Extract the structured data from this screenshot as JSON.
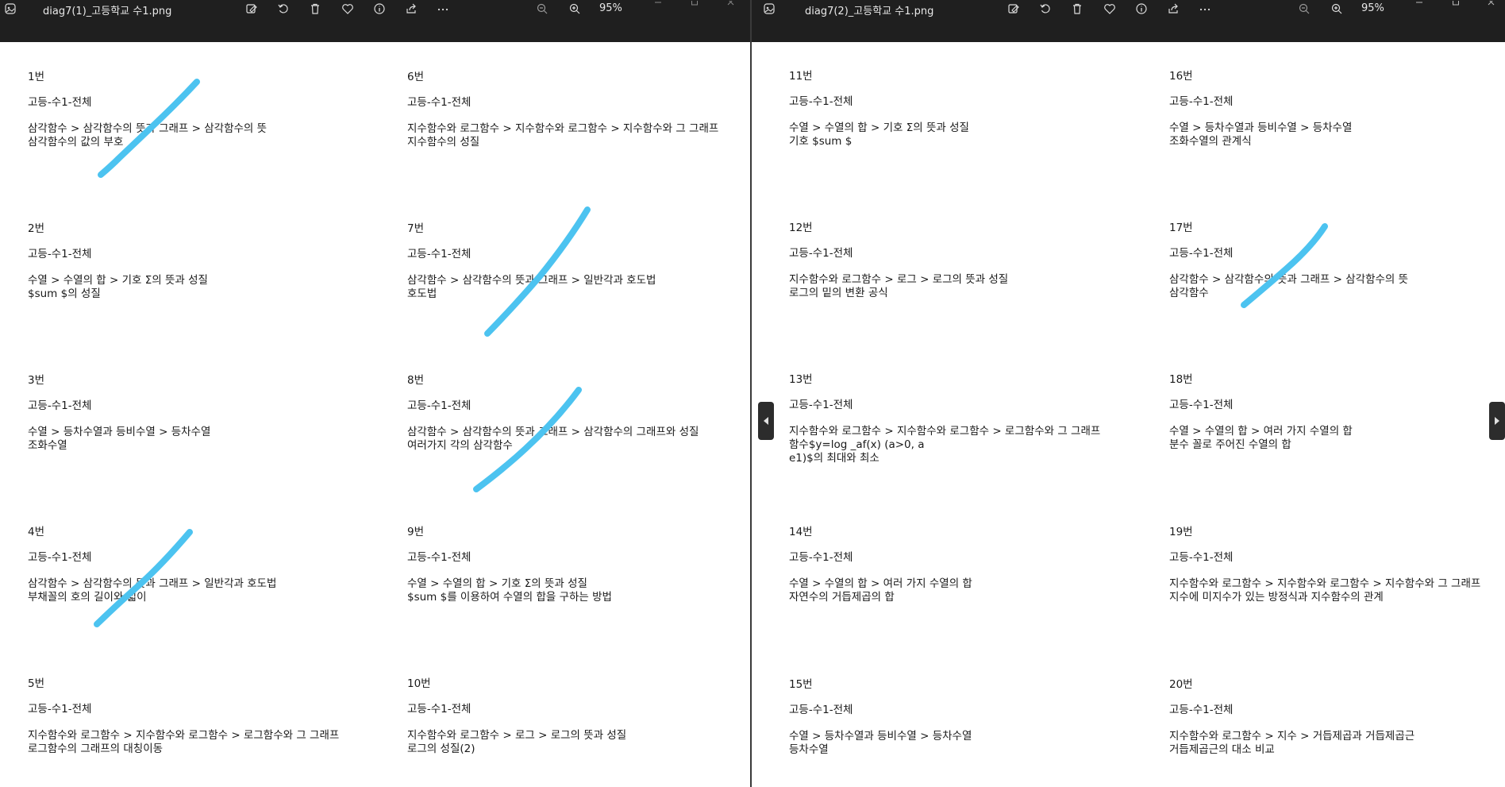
{
  "windows": [
    {
      "filename": "diag7(1)_고등학교 수1.png",
      "zoom": "95%",
      "items": [
        {
          "num": "1번",
          "grade": "고등-수1-전체",
          "path": "삼각함수 > 삼각함수의 뜻과 그래프 > 삼각함수의 뜻",
          "topic": "삼각함수의 값의 부호"
        },
        {
          "num": "2번",
          "grade": "고등-수1-전체",
          "path": "수열 > 수열의 합 > 기호 Σ의 뜻과 성질",
          "topic": "$sum $의 성질"
        },
        {
          "num": "3번",
          "grade": "고등-수1-전체",
          "path": "수열 > 등차수열과 등비수열 > 등차수열",
          "topic": "조화수열"
        },
        {
          "num": "4번",
          "grade": "고등-수1-전체",
          "path": "삼각함수 > 삼각함수의 뜻과 그래프 > 일반각과 호도법",
          "topic": "부채꼴의 호의 길이와 넓이"
        },
        {
          "num": "5번",
          "grade": "고등-수1-전체",
          "path": "지수함수와 로그함수 > 지수함수와 로그함수 > 로그함수와 그 그래프",
          "topic": "로그함수의 그래프의 대칭이동"
        },
        {
          "num": "6번",
          "grade": "고등-수1-전체",
          "path": "지수함수와 로그함수 > 지수함수와 로그함수 > 지수함수와 그 그래프",
          "topic": "지수함수의 성질"
        },
        {
          "num": "7번",
          "grade": "고등-수1-전체",
          "path": "삼각함수 > 삼각함수의 뜻과 그래프 > 일반각과 호도법",
          "topic": "호도법"
        },
        {
          "num": "8번",
          "grade": "고등-수1-전체",
          "path": "삼각함수 > 삼각함수의 뜻과 그래프 > 삼각함수의 그래프와 성질",
          "topic": "여러가지 각의 삼각함수"
        },
        {
          "num": "9번",
          "grade": "고등-수1-전체",
          "path": "수열 > 수열의 합 > 기호 Σ의 뜻과 성질",
          "topic": "$sum $를 이용하여 수열의 합을 구하는 방법"
        },
        {
          "num": "10번",
          "grade": "고등-수1-전체",
          "path": "지수함수와 로그함수 > 로그 > 로그의 뜻과 성질",
          "topic": "로그의 성질(2)"
        }
      ]
    },
    {
      "filename": "diag7(2)_고등학교 수1.png",
      "zoom": "95%",
      "items": [
        {
          "num": "11번",
          "grade": "고등-수1-전체",
          "path": "수열 > 수열의 합 > 기호 Σ의 뜻과 성질",
          "topic": "기호 $sum $"
        },
        {
          "num": "12번",
          "grade": "고등-수1-전체",
          "path": "지수함수와 로그함수 > 로그 > 로그의 뜻과 성질",
          "topic": "로그의 밑의 변환 공식"
        },
        {
          "num": "13번",
          "grade": "고등-수1-전체",
          "path": "지수함수와 로그함수 > 지수함수와 로그함수 > 로그함수와 그 그래프",
          "topic": "함수$y=log _af(x) (a>0, a\ne1)$의 최대와 최소"
        },
        {
          "num": "14번",
          "grade": "고등-수1-전체",
          "path": "수열 > 수열의 합 > 여러 가지 수열의 합",
          "topic": "자연수의 거듭제곱의 합"
        },
        {
          "num": "15번",
          "grade": "고등-수1-전체",
          "path": "수열 > 등차수열과 등비수열 > 등차수열",
          "topic": "등차수열"
        },
        {
          "num": "16번",
          "grade": "고등-수1-전체",
          "path": "수열 > 등차수열과 등비수열 > 등차수열",
          "topic": "조화수열의 관계식"
        },
        {
          "num": "17번",
          "grade": "고등-수1-전체",
          "path": "삼각함수 > 삼각함수의 뜻과 그래프 > 삼각함수의 뜻",
          "topic": "삼각함수"
        },
        {
          "num": "18번",
          "grade": "고등-수1-전체",
          "path": "수열 > 수열의 합 > 여러 가지 수열의 합",
          "topic": "분수 꼴로 주어진 수열의 합"
        },
        {
          "num": "19번",
          "grade": "고등-수1-전체",
          "path": "지수함수와 로그함수 > 지수함수와 로그함수 > 지수함수와 그 그래프",
          "topic": "지수에 미지수가 있는 방정식과 지수함수의 관계"
        },
        {
          "num": "20번",
          "grade": "고등-수1-전체",
          "path": "지수함수와 로그함수 > 지수 > 거듭제곱과 거듭제곱근",
          "topic": "거듭제곱근의 대소 비교"
        }
      ]
    }
  ],
  "annotation_color": "#4cc3f0",
  "marked_items": [
    "1번",
    "4번",
    "7번",
    "8번",
    "17번"
  ],
  "icons": [
    "image-edit-icon",
    "rotate-icon",
    "delete-icon",
    "favorite-icon",
    "info-icon",
    "share-icon",
    "more-icon",
    "zoom-out-icon",
    "zoom-in-icon"
  ]
}
